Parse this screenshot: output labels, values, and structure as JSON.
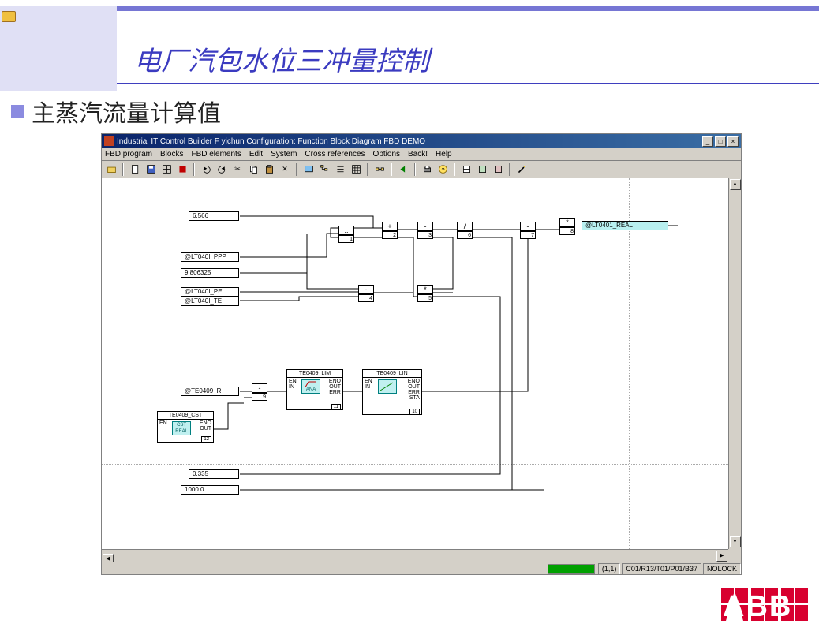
{
  "slide": {
    "title": "电厂汽包水位三冲量控制",
    "subtitle": "主蒸汽流量计算值"
  },
  "app": {
    "window_title": "Industrial IT Control Builder F yichun  Configuration: Function Block Diagram FBD  DEMO",
    "menus": [
      "FBD program",
      "Blocks",
      "FBD elements",
      "Edit",
      "System",
      "Cross references",
      "Options",
      "Back!",
      "Help"
    ],
    "toolbar_icons": [
      "folder",
      "new",
      "save",
      "grid",
      "stop",
      "sep",
      "undo",
      "redo",
      "cut",
      "copy",
      "paste",
      "delete",
      "sep",
      "screen",
      "tree",
      "list",
      "table",
      "sep",
      "connect",
      "sep",
      "back",
      "sep",
      "print",
      "help",
      "sep",
      "block1",
      "block2",
      "block3",
      "sep",
      "wand"
    ],
    "status": {
      "coord": "(1,1)",
      "path": "C01/R13/T01/P01/B37",
      "lock": "NOLOCK"
    }
  },
  "diagram": {
    "inputs": {
      "c1": "6.566",
      "c2": "@LT040I_PPP",
      "c3": "9.806325",
      "c4": "@LT040I_PE",
      "c5": "@LT040I_TE",
      "c6": "@TE0409_R",
      "c7": "0.335",
      "c8": "1000.0"
    },
    "output": "@LT0401_REAL",
    "ops": {
      "b1": {
        "sym": "..",
        "n": "1"
      },
      "b2": {
        "sym": "+",
        "n": "2"
      },
      "b3": {
        "sym": "-",
        "n": "3"
      },
      "b4": {
        "sym": "-",
        "n": "4"
      },
      "b5": {
        "sym": "*",
        "n": "5"
      },
      "b6": {
        "sym": "/",
        "n": "6"
      },
      "b7": {
        "sym": "-",
        "n": "7"
      },
      "b8": {
        "sym": "*",
        "n": "8"
      },
      "b9": {
        "sym": "-",
        "n": "9"
      }
    },
    "fblocks": {
      "cst": {
        "title": "TE0409_CST",
        "lports": [
          "EN"
        ],
        "rports": [
          "ENO",
          "OUT"
        ],
        "icon": "CST REAL",
        "n": "12"
      },
      "lim": {
        "title": "TE0409_LIM",
        "lports": [
          "EN",
          "IN"
        ],
        "rports": [
          "ENO",
          "OUT",
          "ERR"
        ],
        "icon": "ANA",
        "n": "11"
      },
      "lin": {
        "title": "TE0409_LIN",
        "lports": [
          "EN",
          "IN"
        ],
        "rports": [
          "ENO",
          "OUT",
          "ERR",
          "STA"
        ],
        "icon": "",
        "n": "10"
      }
    }
  },
  "logo": "ABB"
}
